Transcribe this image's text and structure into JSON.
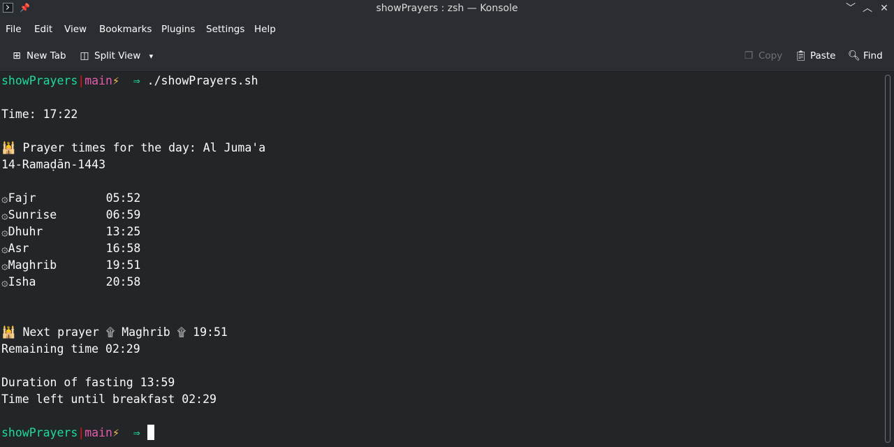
{
  "window": {
    "title": "showPrayers : zsh — Konsole"
  },
  "icons": {
    "app": "konsole-icon",
    "pin": "pin-icon",
    "minimize": "chevron-down-icon",
    "maximize": "chevron-up-icon",
    "close": "close-icon"
  },
  "menu": [
    "File",
    "Edit",
    "View",
    "Bookmarks",
    "Plugins",
    "Settings",
    "Help"
  ],
  "toolbar": {
    "new_tab": "New Tab",
    "split_view": "Split View",
    "copy": "Copy",
    "paste": "Paste",
    "find": "Find"
  },
  "terminal": {
    "prompt": {
      "dir": "showPrayers",
      "sep": "|",
      "branch": "main",
      "flag": "⚡",
      "arrow": "⇒"
    },
    "command": "./showPrayers.sh",
    "time_line": "Time: 17:22",
    "header_icon": "🕌",
    "header_text": "Prayer times for the day: Al Juma'a",
    "hijri_date": "14-Ramaḍān-1443",
    "prayer_icon": "۞",
    "prayers": [
      {
        "name": "Fajr",
        "time": "05:52"
      },
      {
        "name": "Sunrise",
        "time": "06:59"
      },
      {
        "name": "Dhuhr",
        "time": "13:25"
      },
      {
        "name": "Asr",
        "time": "16:58"
      },
      {
        "name": "Maghrib",
        "time": "19:51"
      },
      {
        "name": "Isha",
        "time": "20:58"
      }
    ],
    "next_prayer": {
      "label": "Next prayer",
      "arrow_icon": "۩",
      "name": "Maghrib",
      "time": "19:51"
    },
    "remaining": "Remaining time 02:29",
    "fasting_duration": "Duration of fasting 13:59",
    "breakfast_left": "Time left until breakfast 02:29"
  },
  "colors": {
    "background": "#232629",
    "prompt_dir": "#1cdc9a",
    "prompt_sep": "#ed1515",
    "prompt_branch": "#e85aad",
    "prompt_flag": "#fdbc4b"
  }
}
